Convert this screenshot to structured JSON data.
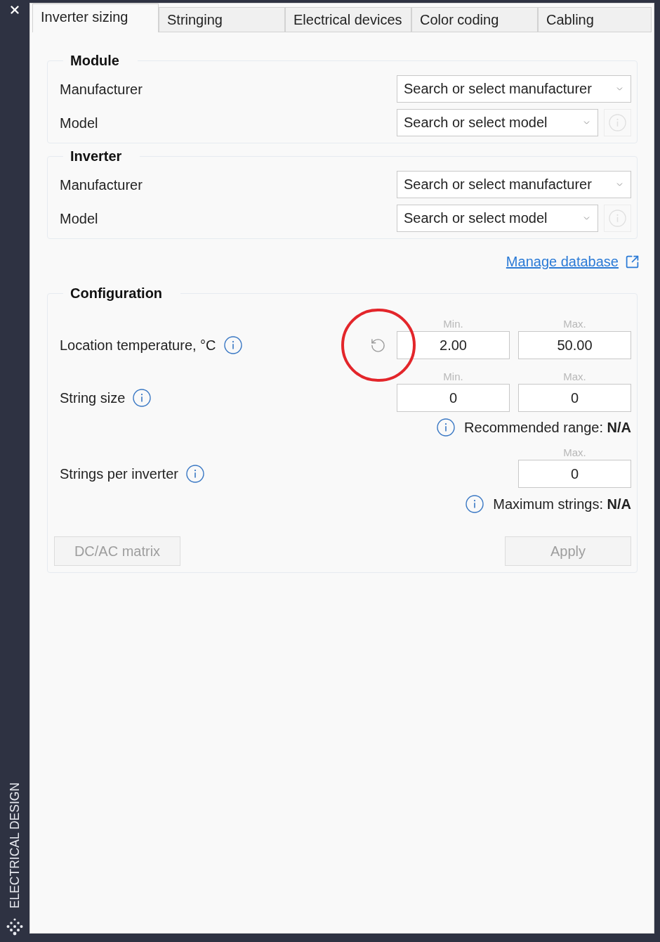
{
  "sidebar": {
    "title": "ELECTRICAL DESIGN"
  },
  "tabs": [
    {
      "label": "Inverter sizing",
      "selected": true
    },
    {
      "label": "Stringing",
      "selected": false
    },
    {
      "label": "Electrical devices",
      "selected": false
    },
    {
      "label": "Color coding",
      "selected": false
    },
    {
      "label": "Cabling",
      "selected": false
    }
  ],
  "groups": [
    {
      "title": "Module",
      "fields": [
        {
          "label": "Manufacturer",
          "placeholder": "Search or select manufacturer"
        },
        {
          "label": "Model",
          "placeholder": "Search or select model",
          "info_button": {
            "disabled": true
          }
        }
      ]
    },
    {
      "title": "Inverter",
      "fields": [
        {
          "label": "Manufacturer",
          "placeholder": "Search or select manufacturer"
        },
        {
          "label": "Model",
          "placeholder": "Search or select model",
          "info_button": {
            "disabled": true
          }
        }
      ]
    }
  ],
  "manage_link": {
    "label": "Manage database"
  },
  "configuration": {
    "title": "Configuration",
    "rows": [
      {
        "label": "Location temperature, °C",
        "reset_button": {
          "highlighted": true
        },
        "inputs": [
          {
            "caption": "Min.",
            "value": "2.00"
          },
          {
            "caption": "Max.",
            "value": "50.00"
          }
        ]
      },
      {
        "label": "String size",
        "inputs": [
          {
            "caption": "Min.",
            "value": "0"
          },
          {
            "caption": "Max.",
            "value": "0"
          }
        ],
        "note": "Recommended range: **N/A**"
      },
      {
        "label": "Strings per inverter",
        "inputs": [
          {
            "caption": "Max.",
            "value": "0"
          }
        ],
        "note": "Maximum strings: **N/A**"
      }
    ],
    "buttons": [
      {
        "label": "DC/AC matrix",
        "disabled": true
      },
      {
        "label": "Apply",
        "disabled": true
      }
    ]
  }
}
